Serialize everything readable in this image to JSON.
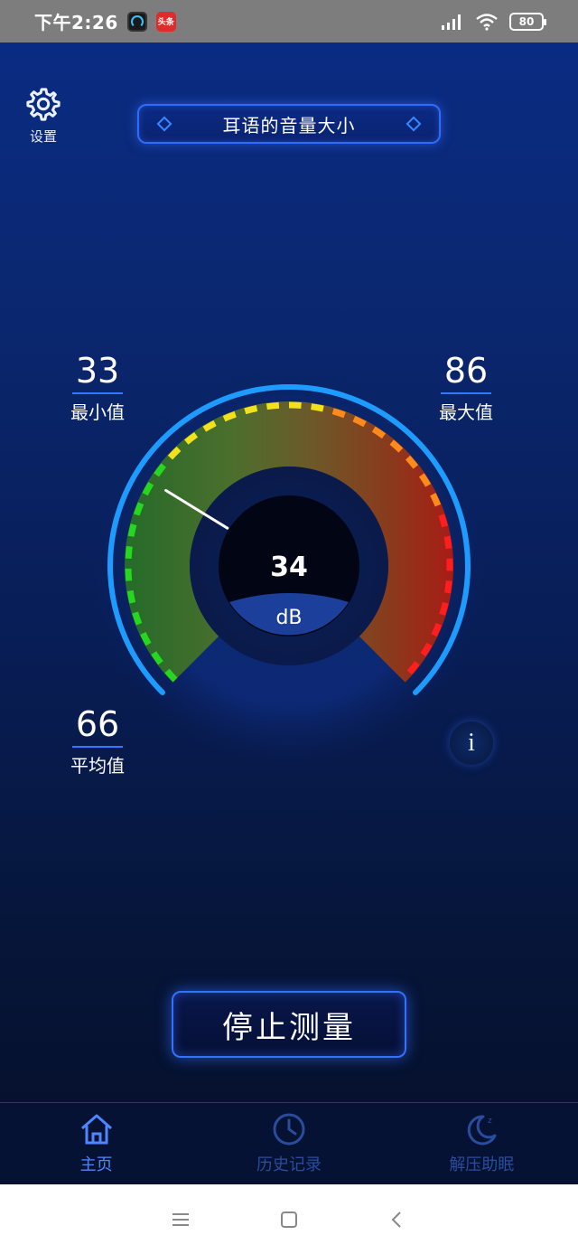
{
  "status_bar": {
    "time": "下午2:26",
    "notif_toutiao": "头条",
    "battery": "80"
  },
  "settings": {
    "label": "设置"
  },
  "mode_selector": {
    "title": "耳语的音量大小"
  },
  "stats": {
    "min": {
      "value": "33",
      "label": "最小值"
    },
    "max": {
      "value": "86",
      "label": "最大值"
    },
    "avg": {
      "value": "66",
      "label": "平均值"
    }
  },
  "gauge": {
    "reading": "34",
    "unit": "dB",
    "needle_db": 34,
    "scale_min_db": 0,
    "scale_max_db": 120,
    "colors": {
      "green": "#27d61e",
      "yellow": "#f2e21c",
      "orange": "#ff8a1c",
      "red": "#ff1d1d",
      "ring": "#1e9bff"
    }
  },
  "info_button": {
    "label": "i"
  },
  "stop_button": {
    "label": "停止测量"
  },
  "bottom_nav": {
    "items": [
      {
        "label": "主页",
        "icon": "home-icon",
        "active": true
      },
      {
        "label": "历史记录",
        "icon": "clock-icon",
        "active": false
      },
      {
        "label": "解压助眠",
        "icon": "moon-icon",
        "active": false
      }
    ]
  },
  "colors": {
    "accent": "#2f6bff",
    "background": "#0a2770",
    "nav_active": "#4f86ff",
    "nav_inactive": "#2a4c9c"
  }
}
